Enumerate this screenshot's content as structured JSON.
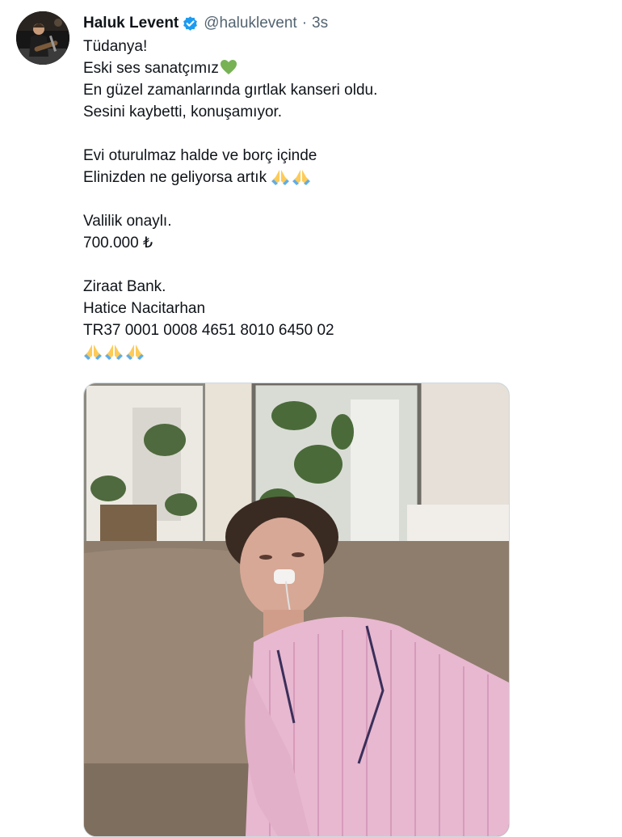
{
  "tweet": {
    "author": {
      "display_name": "Haluk Levent",
      "handle": "@haluklevent",
      "verified_icon": "verified-badge-icon",
      "avatar": "avatar-photo-guitarist"
    },
    "separator": "·",
    "timestamp": "3s",
    "lines": {
      "l1": "Tüdanya!",
      "l2": "Eski ses sanatçımız",
      "l3": "En güzel zamanlarında gırtlak kanseri oldu.",
      "l4": "Sesini kaybetti, konuşamıyor.",
      "l5": "Evi oturulmaz halde ve borç içinde",
      "l6": "Elinizden ne geliyorsa artık",
      "l7": "Valilik onaylı.",
      "l8": "700.000 ₺",
      "l9": "Ziraat Bank.",
      "l10": "Hatice Nacitarhan",
      "l11": "TR37 0001 0008 4651 8010 6450 02"
    },
    "emoji": {
      "green_heart": "green-heart-emoji",
      "folded_hands": "folded-hands-emoji"
    },
    "media": {
      "type": "photo",
      "subject": "photo-woman-on-couch"
    },
    "colors": {
      "text": "#0f1419",
      "secondary": "#536471",
      "verified_blue": "#1d9bf0",
      "heart_green": "#77b255",
      "pray_yellow": "#fdcb58"
    }
  }
}
